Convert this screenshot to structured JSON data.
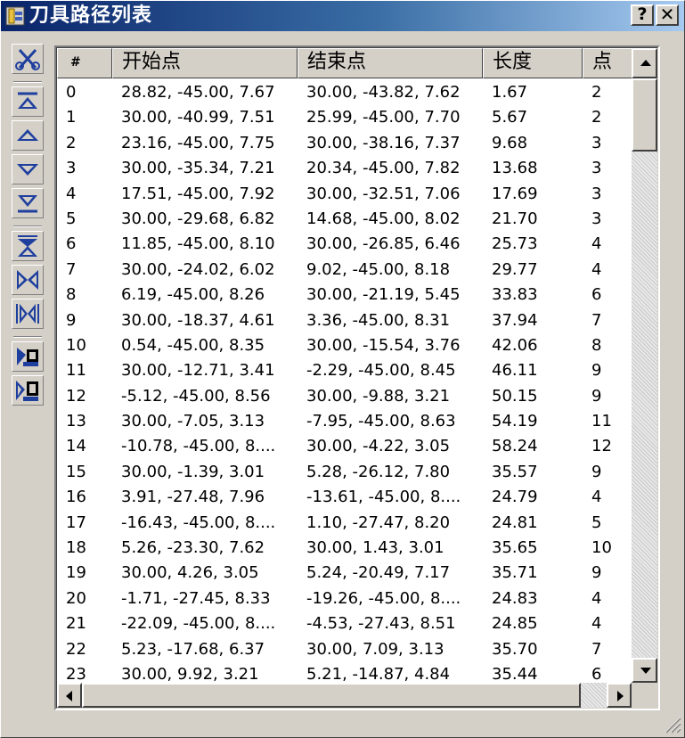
{
  "window": {
    "title": "刀具路径列表",
    "help_label": "?",
    "close_label": "✕"
  },
  "toolbar": {
    "buttons": [
      {
        "name": "scissors-icon"
      },
      {
        "name": "move-to-top-icon"
      },
      {
        "name": "move-up-icon"
      },
      {
        "name": "move-down-icon"
      },
      {
        "name": "move-to-bottom-icon"
      },
      {
        "name": "reverse-up-icon"
      },
      {
        "name": "reverse-direction-icon"
      },
      {
        "name": "reverse-all-icon"
      },
      {
        "name": "optimize-icon"
      },
      {
        "name": "optimize-all-icon"
      }
    ]
  },
  "table": {
    "columns": [
      "#",
      "开始点",
      "结束点",
      "长度",
      "点"
    ],
    "rows": [
      [
        "0",
        "28.82, -45.00, 7.67",
        "30.00, -43.82, 7.62",
        "1.67",
        "2"
      ],
      [
        "1",
        "30.00, -40.99, 7.51",
        "25.99, -45.00, 7.70",
        "5.67",
        "2"
      ],
      [
        "2",
        "23.16, -45.00, 7.75",
        "30.00, -38.16, 7.37",
        "9.68",
        "3"
      ],
      [
        "3",
        "30.00, -35.34, 7.21",
        "20.34, -45.00, 7.82",
        "13.68",
        "3"
      ],
      [
        "4",
        "17.51, -45.00, 7.92",
        "30.00, -32.51, 7.06",
        "17.69",
        "3"
      ],
      [
        "5",
        "30.00, -29.68, 6.82",
        "14.68, -45.00, 8.02",
        "21.70",
        "3"
      ],
      [
        "6",
        "11.85, -45.00, 8.10",
        "30.00, -26.85, 6.46",
        "25.73",
        "4"
      ],
      [
        "7",
        "30.00, -24.02, 6.02",
        "9.02, -45.00, 8.18",
        "29.77",
        "4"
      ],
      [
        "8",
        "6.19, -45.00, 8.26",
        "30.00, -21.19, 5.45",
        "33.83",
        "6"
      ],
      [
        "9",
        "30.00, -18.37, 4.61",
        "3.36, -45.00, 8.31",
        "37.94",
        "7"
      ],
      [
        "10",
        "0.54, -45.00, 8.35",
        "30.00, -15.54, 3.76",
        "42.06",
        "8"
      ],
      [
        "11",
        "30.00, -12.71, 3.41",
        "-2.29, -45.00, 8.45",
        "46.11",
        "9"
      ],
      [
        "12",
        "-5.12, -45.00, 8.56",
        "30.00, -9.88, 3.21",
        "50.15",
        "9"
      ],
      [
        "13",
        "30.00, -7.05, 3.13",
        "-7.95, -45.00, 8.63",
        "54.19",
        "11"
      ],
      [
        "14",
        "-10.78, -45.00, 8....",
        "30.00, -4.22, 3.05",
        "58.24",
        "12"
      ],
      [
        "15",
        "30.00, -1.39, 3.01",
        "5.28, -26.12, 7.80",
        "35.57",
        "9"
      ],
      [
        "16",
        "3.91, -27.48, 7.96",
        "-13.61, -45.00, 8....",
        "24.79",
        "4"
      ],
      [
        "17",
        "-16.43, -45.00, 8....",
        "1.10, -27.47, 8.20",
        "24.81",
        "5"
      ],
      [
        "18",
        "5.26, -23.30, 7.62",
        "30.00, 1.43, 3.01",
        "35.65",
        "10"
      ],
      [
        "19",
        "30.00, 4.26, 3.05",
        "5.24, -20.49, 7.17",
        "35.71",
        "9"
      ],
      [
        "20",
        "-1.71, -27.45, 8.33",
        "-19.26, -45.00, 8....",
        "24.83",
        "4"
      ],
      [
        "21",
        "-22.09, -45.00, 8....",
        "-4.53, -27.43, 8.51",
        "24.85",
        "4"
      ],
      [
        "22",
        "5.23, -17.68, 6.37",
        "30.00, 7.09, 3.13",
        "35.70",
        "7"
      ],
      [
        "23",
        "30.00, 9.92, 3.21",
        "5.21, -14.87, 4.84",
        "35.44",
        "6"
      ]
    ]
  },
  "colors": {
    "title_start": "#0a246a",
    "title_end": "#a6caf0",
    "face": "#d4d0c8",
    "icon_blue": "#1f3f9f"
  }
}
